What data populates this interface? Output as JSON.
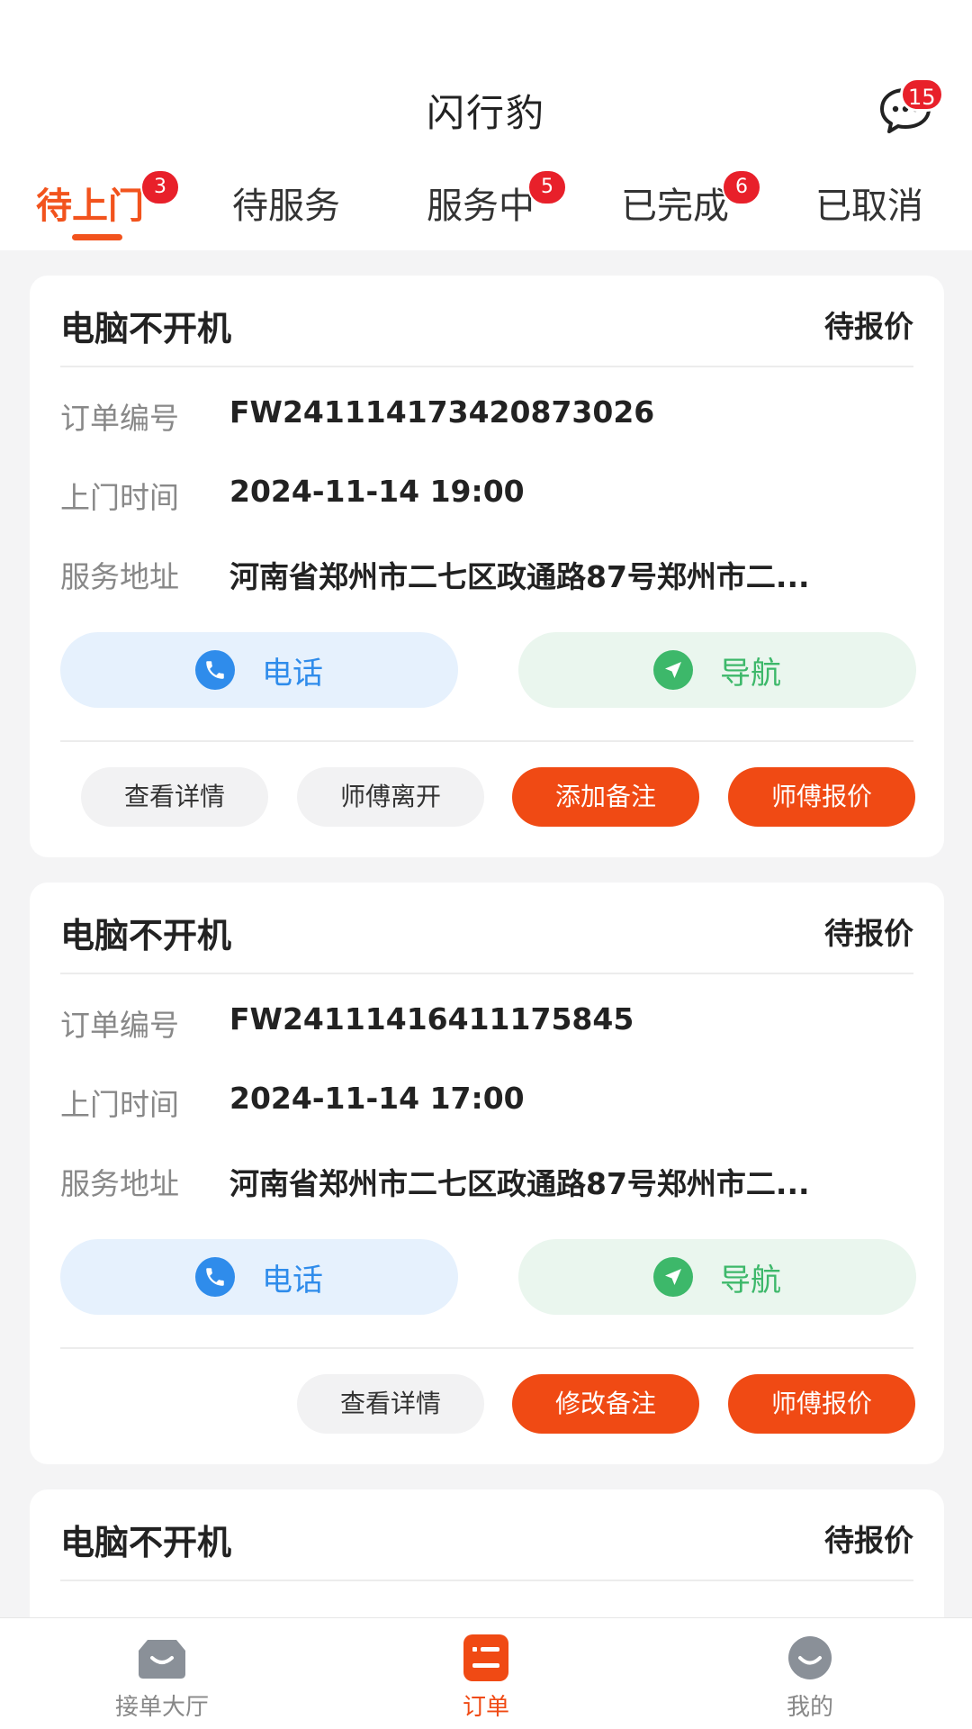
{
  "header": {
    "title": "闪行豹",
    "message_badge": "15"
  },
  "tabs": [
    {
      "label": "待上门",
      "badge": "3",
      "active": true
    },
    {
      "label": "待服务",
      "badge": "",
      "active": false
    },
    {
      "label": "服务中",
      "badge": "5",
      "active": false
    },
    {
      "label": "已完成",
      "badge": "6",
      "active": false
    },
    {
      "label": "已取消",
      "badge": "",
      "active": false
    }
  ],
  "labels": {
    "order_no": "订单编号",
    "visit_time": "上门时间",
    "address": "服务地址",
    "call": "电话",
    "navigate": "导航"
  },
  "orders": [
    {
      "title": "电脑不开机",
      "status": "待报价",
      "order_no": "FW24111417342087302 6",
      "visit_time": "2024-11-14 19:00",
      "address": "河南省郑州市二七区政通路87号郑州市二...",
      "actions": [
        "查看详情",
        "师傅离开",
        "添加备注",
        "师傅报价"
      ]
    },
    {
      "title": "电脑不开机",
      "status": "待报价",
      "order_no": "FW24111416411175845",
      "visit_time": "2024-11-14 17:00",
      "address": "河南省郑州市二七区政通路87号郑州市二...",
      "actions": [
        "查看详情",
        "修改备注",
        "师傅报价"
      ]
    },
    {
      "title": "电脑不开机",
      "status": "待报价"
    }
  ],
  "bottom_nav": [
    {
      "label": "接单大厅",
      "icon": "hall-icon",
      "active": false
    },
    {
      "label": "订单",
      "icon": "order-list-icon",
      "active": true
    },
    {
      "label": "我的",
      "icon": "profile-icon",
      "active": false
    }
  ],
  "colors": {
    "accent": "#f04a14",
    "badge": "#e8202a",
    "call": "#2f8ceb",
    "navigate": "#3db86a"
  }
}
